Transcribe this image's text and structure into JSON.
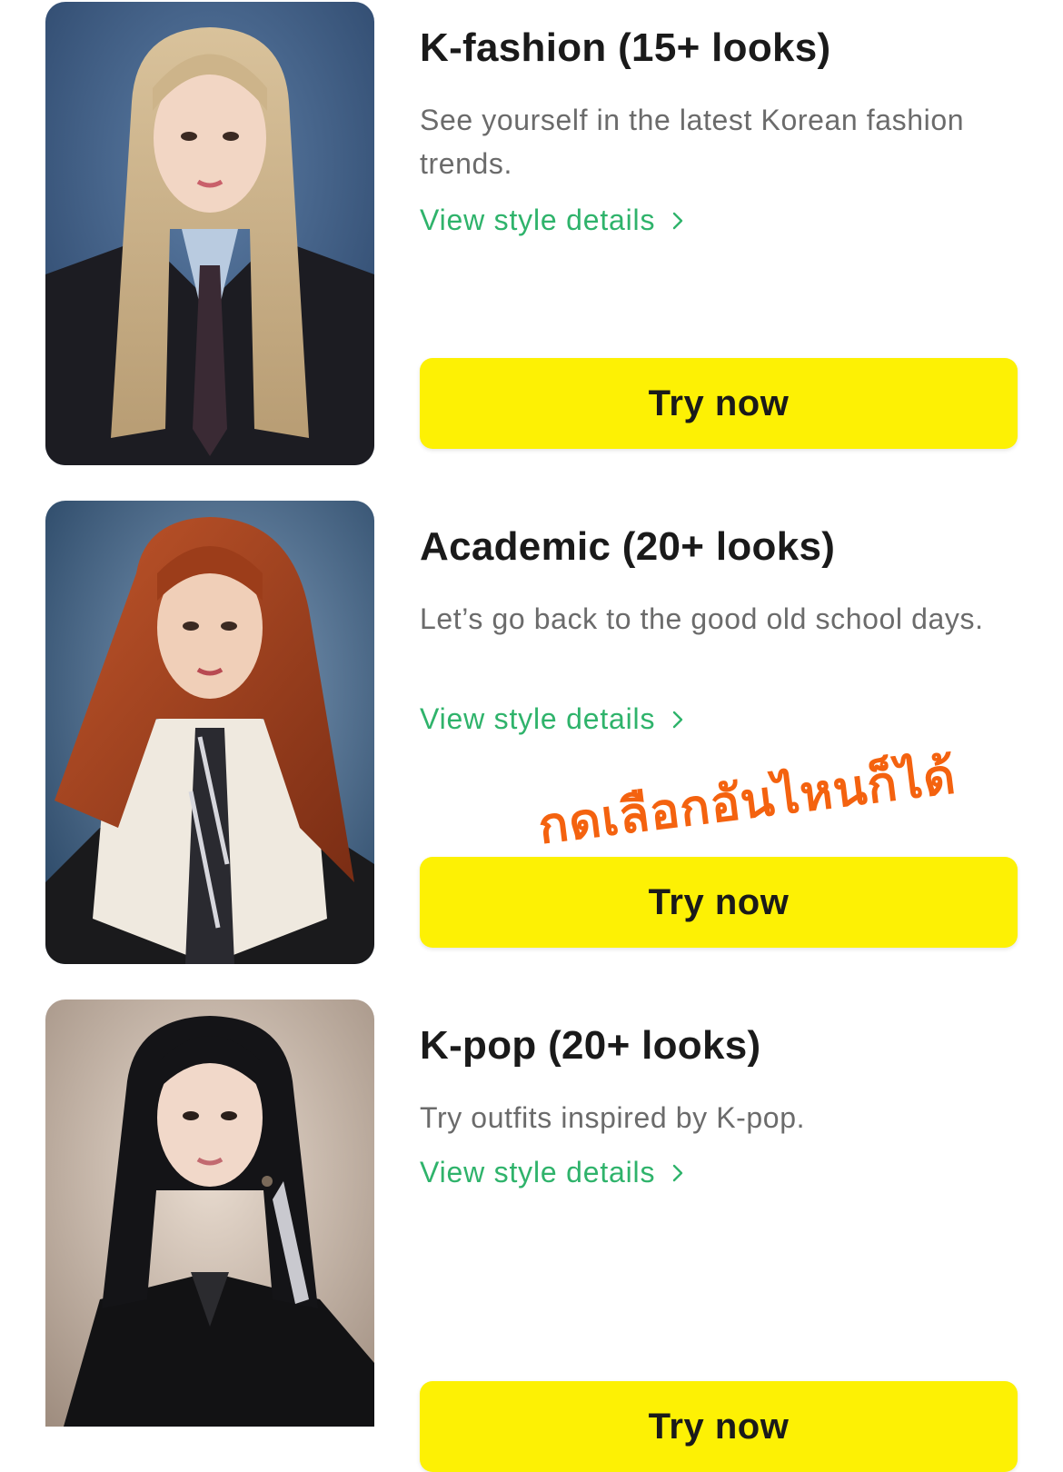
{
  "styles": [
    {
      "title": "K-fashion (15+ looks)",
      "description": "See yourself in the latest Korean fashion trends.",
      "details_label": "View style details",
      "button_label": "Try now"
    },
    {
      "title": "Academic (20+ looks)",
      "description": "Let’s go back to the good old school days.",
      "details_label": "View style details",
      "button_label": "Try now"
    },
    {
      "title": "K-pop (20+ looks)",
      "description": "Try outfits inspired by K-pop.",
      "details_label": "View style details",
      "button_label": "Try now"
    }
  ],
  "annotation": {
    "text": "กดเลือกอันไหนก็ได้",
    "color": "#f4620f"
  },
  "colors": {
    "accent_yellow": "#fdf104",
    "link_green": "#2fb36b"
  }
}
